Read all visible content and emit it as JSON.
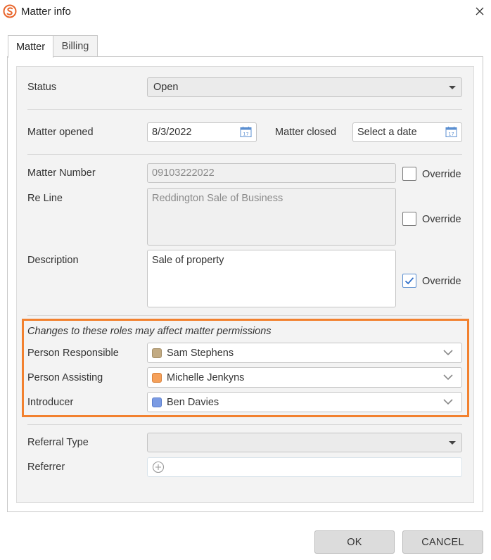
{
  "window": {
    "title": "Matter info",
    "logo_icon": "app-logo-icon",
    "close_icon": "close-icon"
  },
  "tabs": [
    {
      "label": "Matter",
      "active": true
    },
    {
      "label": "Billing",
      "active": false
    }
  ],
  "status": {
    "label": "Status",
    "value": "Open"
  },
  "dates": {
    "opened_label": "Matter opened",
    "opened_value": "8/3/2022",
    "closed_label": "Matter closed",
    "closed_placeholder": "Select a date",
    "calendar_day": "17"
  },
  "matter_number": {
    "label": "Matter Number",
    "value": "09103222022",
    "override_label": "Override",
    "override_checked": false
  },
  "re_line": {
    "label": "Re Line",
    "value": "Reddington Sale of Business",
    "override_label": "Override",
    "override_checked": false
  },
  "description": {
    "label": "Description",
    "value": "Sale of property",
    "override_label": "Override",
    "override_checked": true
  },
  "roles": {
    "note": "Changes to these roles may affect matter permissions",
    "accent_color": "#f2812f",
    "items": [
      {
        "label": "Person Responsible",
        "value": "Sam Stephens",
        "color": "#c2aa82"
      },
      {
        "label": "Person Assisting",
        "value": "Michelle Jenkyns",
        "color": "#f5a05a"
      },
      {
        "label": "Introducer",
        "value": "Ben Davies",
        "color": "#7b9be3"
      }
    ]
  },
  "referral": {
    "type_label": "Referral Type",
    "type_value": "",
    "referrer_label": "Referrer"
  },
  "buttons": {
    "ok": "OK",
    "cancel": "CANCEL"
  }
}
